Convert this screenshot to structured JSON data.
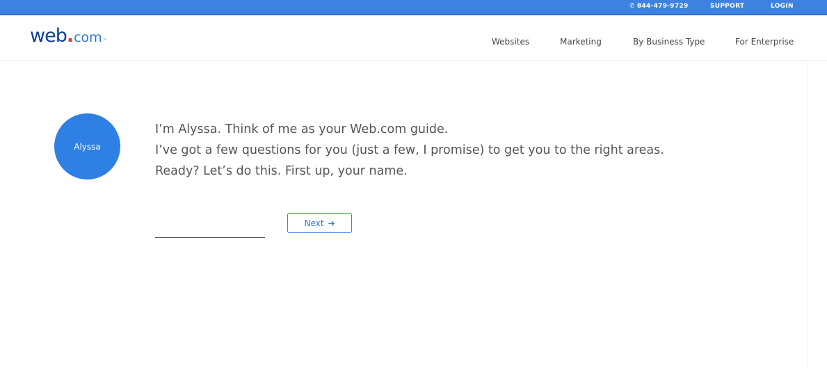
{
  "topbar": {
    "phone_icon": "phone-icon",
    "phone": "844-479-9729",
    "support": "SUPPORT",
    "login": "LOGIN"
  },
  "header": {
    "logo": {
      "web": "web",
      "dot": ".",
      "com": "com",
      "tm": "™"
    },
    "nav": {
      "websites": "Websites",
      "marketing": "Marketing",
      "business_type": "By Business Type",
      "enterprise": "For Enterprise"
    }
  },
  "guide": {
    "avatar_label": "Alyssa",
    "lines": [
      "I’m Alyssa. Think of me as your Web.com guide.",
      "I’ve got a few questions for you (just a few, I promise) to get you to the right areas.",
      "Ready? Let’s do this. First up, your name."
    ]
  },
  "form": {
    "name_value": "",
    "next_label": "Next",
    "next_icon": "arrow-right-icon"
  },
  "colors": {
    "topbar": "#3d82e0",
    "avatar": "#2f80e4",
    "logo_dark": "#0d3f8f",
    "logo_dot": "#e33b2e"
  }
}
